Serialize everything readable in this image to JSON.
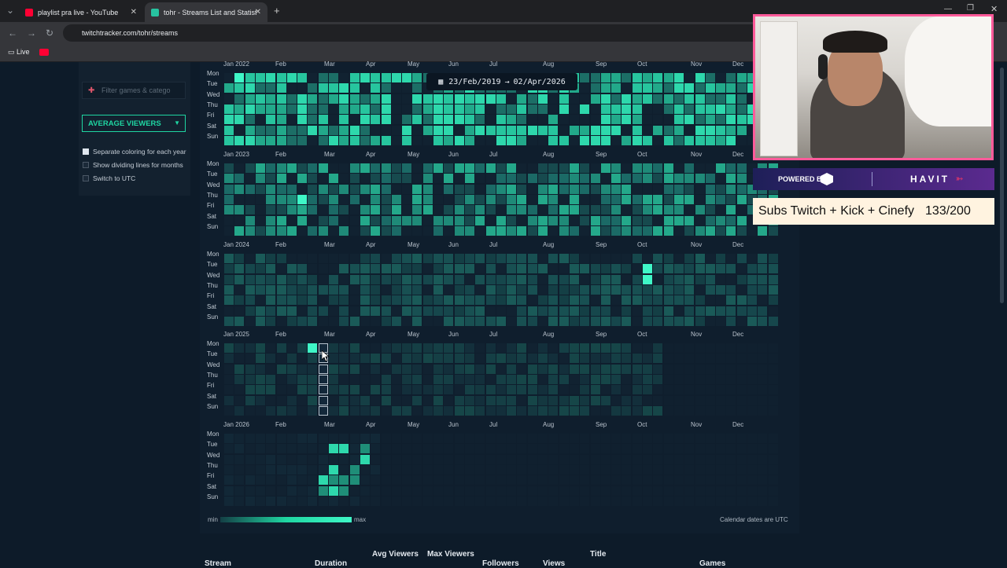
{
  "browser": {
    "tabs": [
      {
        "title": "playlist pra live - YouTube"
      },
      {
        "title": "tohr - Streams List and Statistic"
      }
    ],
    "url": "twitchtracker.com/tohr/streams",
    "bookmarks": [
      {
        "label": "Live"
      }
    ]
  },
  "sidebar": {
    "filter_placeholder": "Filter games & catego",
    "metric": "AVERAGE VIEWERS",
    "options": [
      {
        "label": "Separate coloring for each year",
        "checked": true
      },
      {
        "label": "Show dividing lines for months",
        "checked": false
      },
      {
        "label": "Switch to UTC",
        "checked": false
      }
    ]
  },
  "calendar": {
    "date_range_start": "23/Feb/2019",
    "date_range_end": "02/Apr/2026",
    "days": [
      "Mon",
      "Tue",
      "Wed",
      "Thu",
      "Fri",
      "Sat",
      "Sun"
    ],
    "years": [
      {
        "label": "Jan 2022",
        "months": [
          "Feb",
          "Mar",
          "Apr",
          "May",
          "Jun",
          "Jul",
          "Aug",
          "Sep",
          "Oct",
          "Nov",
          "Dec"
        ]
      },
      {
        "label": "Jan 2023",
        "months": [
          "Feb",
          "Mar",
          "Apr",
          "May",
          "Jun",
          "Jul",
          "Aug",
          "Sep",
          "Oct",
          "Nov",
          "Dec"
        ]
      },
      {
        "label": "Jan 2024",
        "months": [
          "Feb",
          "Mar",
          "Apr",
          "May",
          "Jun",
          "Jul",
          "Aug",
          "Sep",
          "Oct",
          "Nov",
          "Dec"
        ]
      },
      {
        "label": "Jan 2025",
        "months": [
          "Feb",
          "Mar",
          "Apr",
          "May",
          "Jun",
          "Jul",
          "Aug",
          "Sep",
          "Oct",
          "Nov",
          "Dec"
        ]
      },
      {
        "label": "Jan 2026",
        "months": [
          "Feb",
          "Mar",
          "Apr",
          "May",
          "Jun",
          "Jul",
          "Aug",
          "Sep",
          "Oct",
          "Nov",
          "Dec"
        ]
      }
    ],
    "legend_min": "min",
    "legend_max": "max",
    "note": "Calendar dates are UTC"
  },
  "table_headers": [
    "Stream",
    "Duration",
    "Avg Viewers",
    "Max Viewers",
    "Followers",
    "Views",
    "Title",
    "Games"
  ],
  "overlay": {
    "sponsor_label": "POWERED BY",
    "sponsor_brand": "HAVIT",
    "subs_text": "Subs Twitch + Kick + Cinefy",
    "subs_count": "133/200"
  },
  "colors": {
    "accent": "#1fd6a2",
    "bright": "#3ff7c7",
    "cell_low": "#143a43",
    "cell_empty": "#112231",
    "webcam_border": "#ff5a9a"
  }
}
